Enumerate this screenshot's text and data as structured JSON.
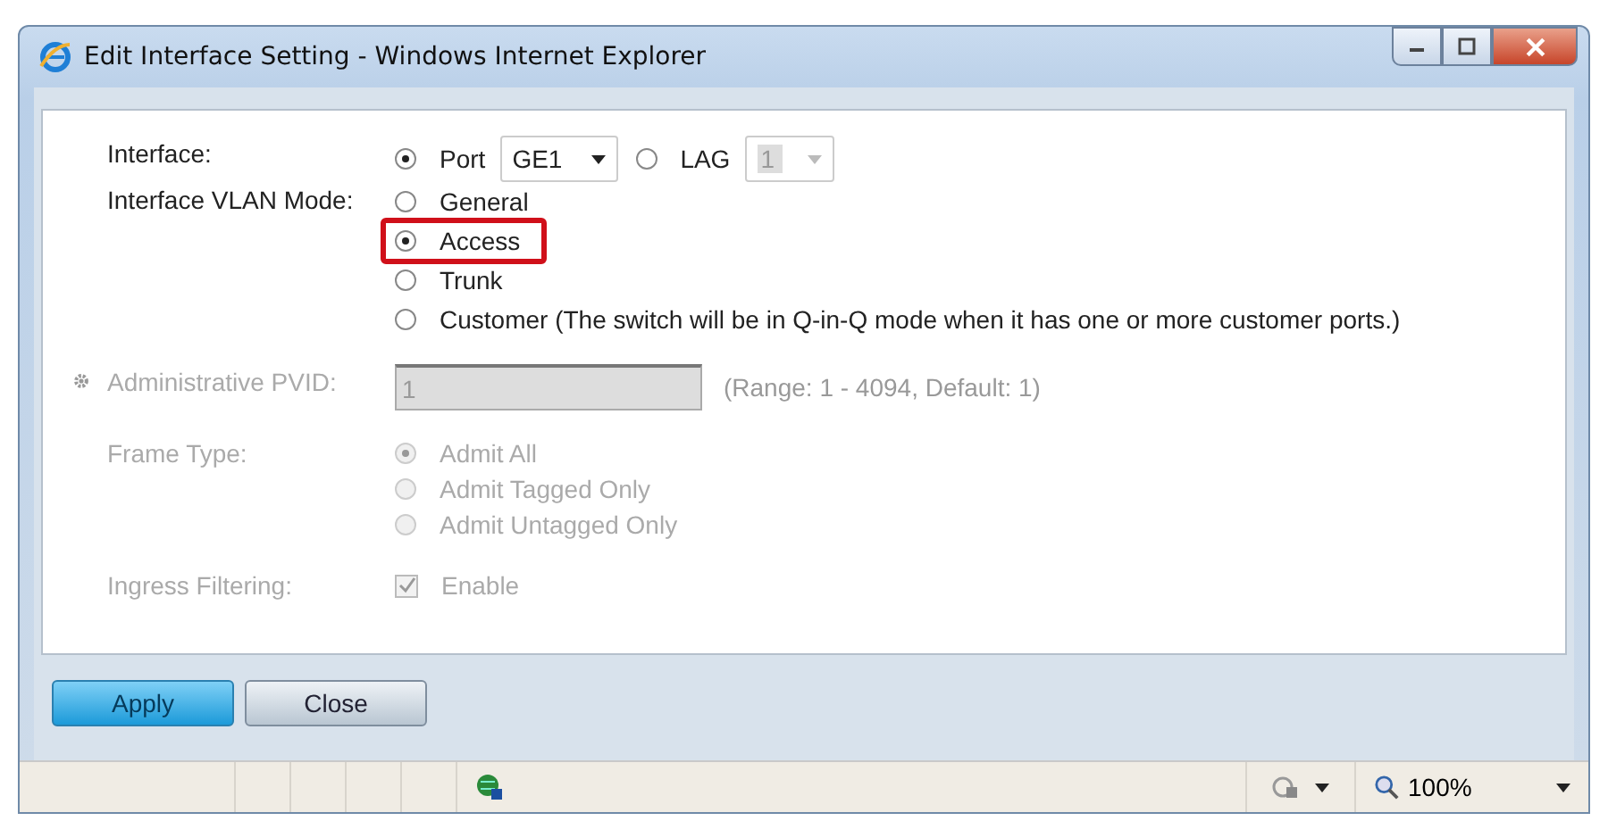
{
  "window": {
    "title": "Edit Interface Setting - Windows Internet Explorer"
  },
  "interface": {
    "label": "Interface:",
    "options": [
      {
        "label": "Port",
        "selected": true,
        "select": {
          "value": "GE1",
          "disabled": false
        }
      },
      {
        "label": "LAG",
        "selected": false,
        "select": {
          "value": "1",
          "disabled": true
        }
      }
    ]
  },
  "vlan_mode": {
    "label": "Interface VLAN Mode:",
    "options": [
      {
        "label": "General",
        "selected": false,
        "highlighted": false
      },
      {
        "label": "Access",
        "selected": true,
        "highlighted": true
      },
      {
        "label": "Trunk",
        "selected": false,
        "highlighted": false
      },
      {
        "label": "Customer (The switch will be in Q-in-Q mode when it has one or more customer ports.)",
        "selected": false,
        "highlighted": false
      }
    ]
  },
  "pvid": {
    "label": "Administrative PVID:",
    "value": "1",
    "hint": "(Range: 1 - 4094, Default: 1)",
    "disabled": true
  },
  "frame_type": {
    "label": "Frame Type:",
    "disabled": true,
    "options": [
      {
        "label": "Admit All",
        "selected": true
      },
      {
        "label": "Admit Tagged Only",
        "selected": false
      },
      {
        "label": "Admit Untagged Only",
        "selected": false
      }
    ]
  },
  "ingress_filtering": {
    "label": "Ingress Filtering:",
    "option": "Enable",
    "checked": true,
    "disabled": true
  },
  "buttons": [
    {
      "label": "Apply",
      "kind": "primary"
    },
    {
      "label": "Close",
      "kind": "normal"
    }
  ],
  "status_bar": {
    "zoom": "100%"
  }
}
